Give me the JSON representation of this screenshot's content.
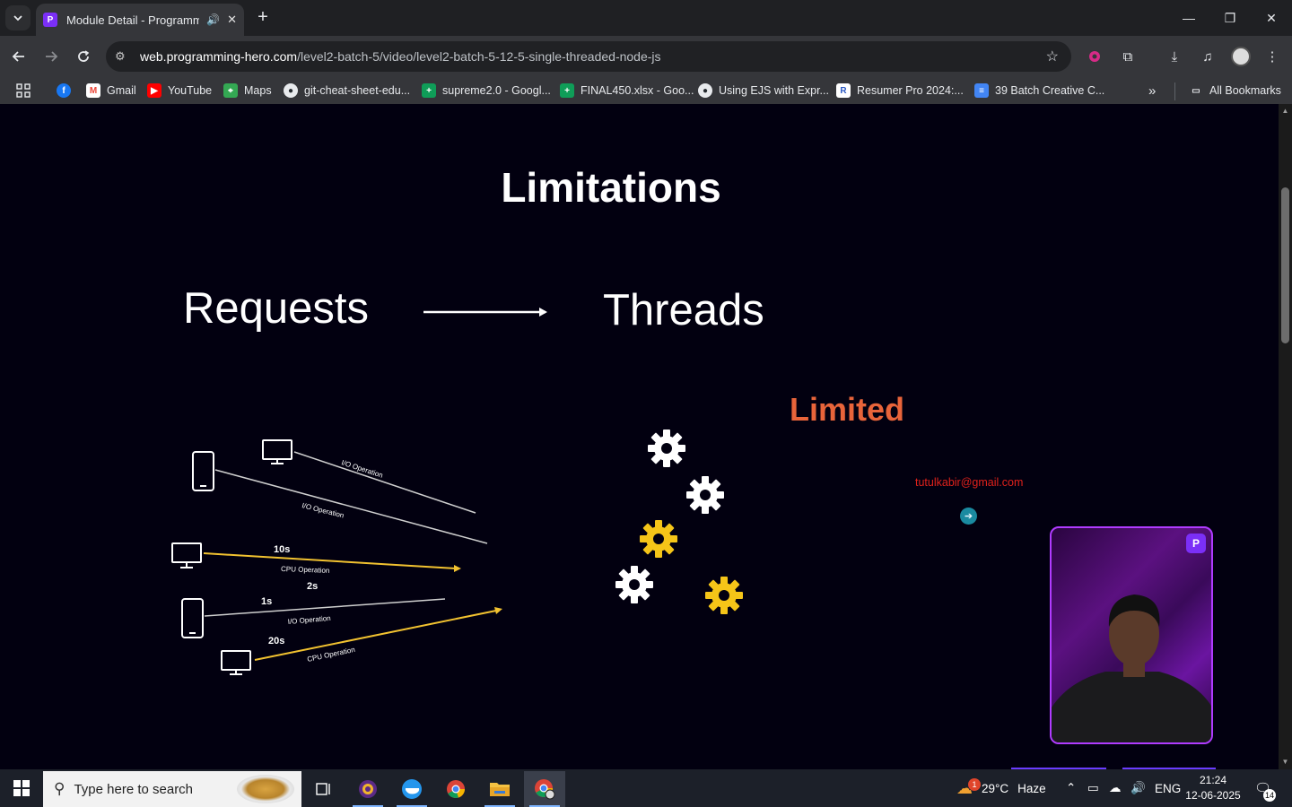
{
  "browser": {
    "tab": {
      "title": "Module Detail - Programming Hero",
      "audio_icon": "speaker-icon"
    },
    "window_controls": {
      "minimize": "—",
      "restore": "❐",
      "close": "✕"
    },
    "url": {
      "host": "web.programming-hero.com",
      "path": "/level2-batch-5/video/level2-batch-5-12-5-single-threaded-node-js"
    },
    "bookmarks": [
      {
        "label": "",
        "icon": "facebook-icon",
        "color": "#1877f2"
      },
      {
        "label": "Gmail",
        "icon": "gmail-icon",
        "color": "#ea4335"
      },
      {
        "label": "YouTube",
        "icon": "youtube-icon",
        "color": "#ff0000"
      },
      {
        "label": "Maps",
        "icon": "maps-icon",
        "color": "#34a853"
      },
      {
        "label": "git-cheat-sheet-edu...",
        "icon": "github-icon",
        "color": "#24292e"
      },
      {
        "label": "supreme2.0 - Googl...",
        "icon": "sheets-icon",
        "color": "#0f9d58"
      },
      {
        "label": "FINAL450.xlsx - Goo...",
        "icon": "sheets-icon",
        "color": "#0f9d58"
      },
      {
        "label": "Using EJS with Expr...",
        "icon": "github-icon",
        "color": "#24292e"
      },
      {
        "label": "Resumer Pro 2024:...",
        "icon": "resumer-icon",
        "color": "#2b59c3"
      },
      {
        "label": "39 Batch Creative C...",
        "icon": "docs-icon",
        "color": "#4285f4"
      }
    ],
    "all_bookmarks": "All Bookmarks",
    "more_bookmarks": "»"
  },
  "slide": {
    "title": "Limitations",
    "left_heading": "Requests",
    "right_heading": "Threads",
    "limited_label": "Limited",
    "watermark_email": "tutulkabir@gmail.com",
    "operations": [
      {
        "time": "",
        "label": "I/O Operation",
        "kind": "io"
      },
      {
        "time": "2s",
        "label": "I/O Operation",
        "kind": "io"
      },
      {
        "time": "10s",
        "label": "CPU Operation",
        "kind": "cpu"
      },
      {
        "time": "1s",
        "label": "I/O Operation",
        "kind": "io"
      },
      {
        "time": "20s",
        "label": "CPU Operation",
        "kind": "cpu"
      }
    ],
    "gear_colors": {
      "white": "#ffffff",
      "yellow": "#f5c518"
    },
    "accent_limited": "#e8643a",
    "watermark_color": "#e0211b"
  },
  "taskbar": {
    "search_placeholder": "Type here to search",
    "weather": {
      "temp": "29°C",
      "condition": "Haze",
      "alert_count": "1"
    },
    "language": "ENG",
    "time": "21:24",
    "date": "12-06-2025",
    "notification_count": "14"
  }
}
